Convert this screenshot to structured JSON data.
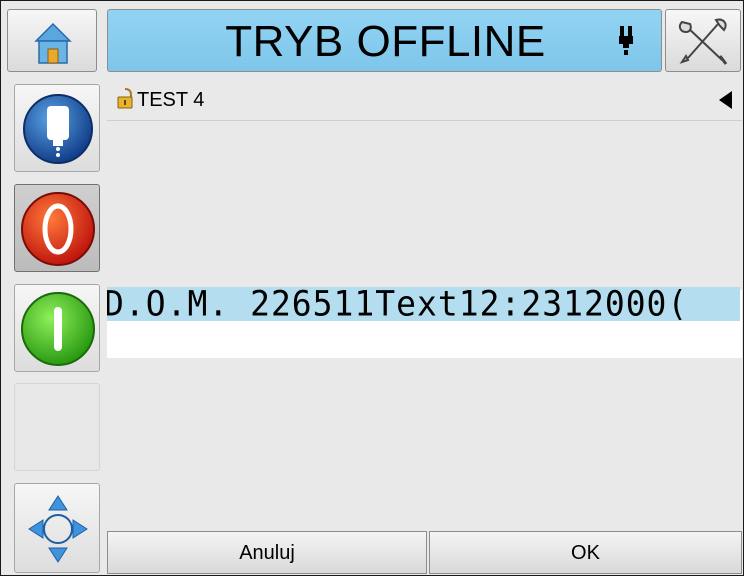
{
  "header": {
    "status_title": "TRYB OFFLINE",
    "status_color": "#86cbee",
    "home_icon": "home-icon",
    "tools_icon": "tools-icon",
    "printhead_icon": "printhead-icon"
  },
  "sidebar": {
    "buttons": [
      {
        "name": "ink-status-button",
        "icon": "ink-cartridge-icon"
      },
      {
        "name": "stop-button",
        "icon": "stop-icon",
        "pressed": true
      },
      {
        "name": "start-button",
        "icon": "start-icon"
      },
      {
        "name": "empty-slot"
      },
      {
        "name": "navigate-button",
        "icon": "navigation-arrows-icon"
      }
    ]
  },
  "job": {
    "name": "TEST 4",
    "lock_icon": "unlock-icon"
  },
  "preview": {
    "message_text": "D.O.M. 226511Text12:2312000("
  },
  "footer": {
    "cancel_label": "Anuluj",
    "ok_label": "OK"
  }
}
